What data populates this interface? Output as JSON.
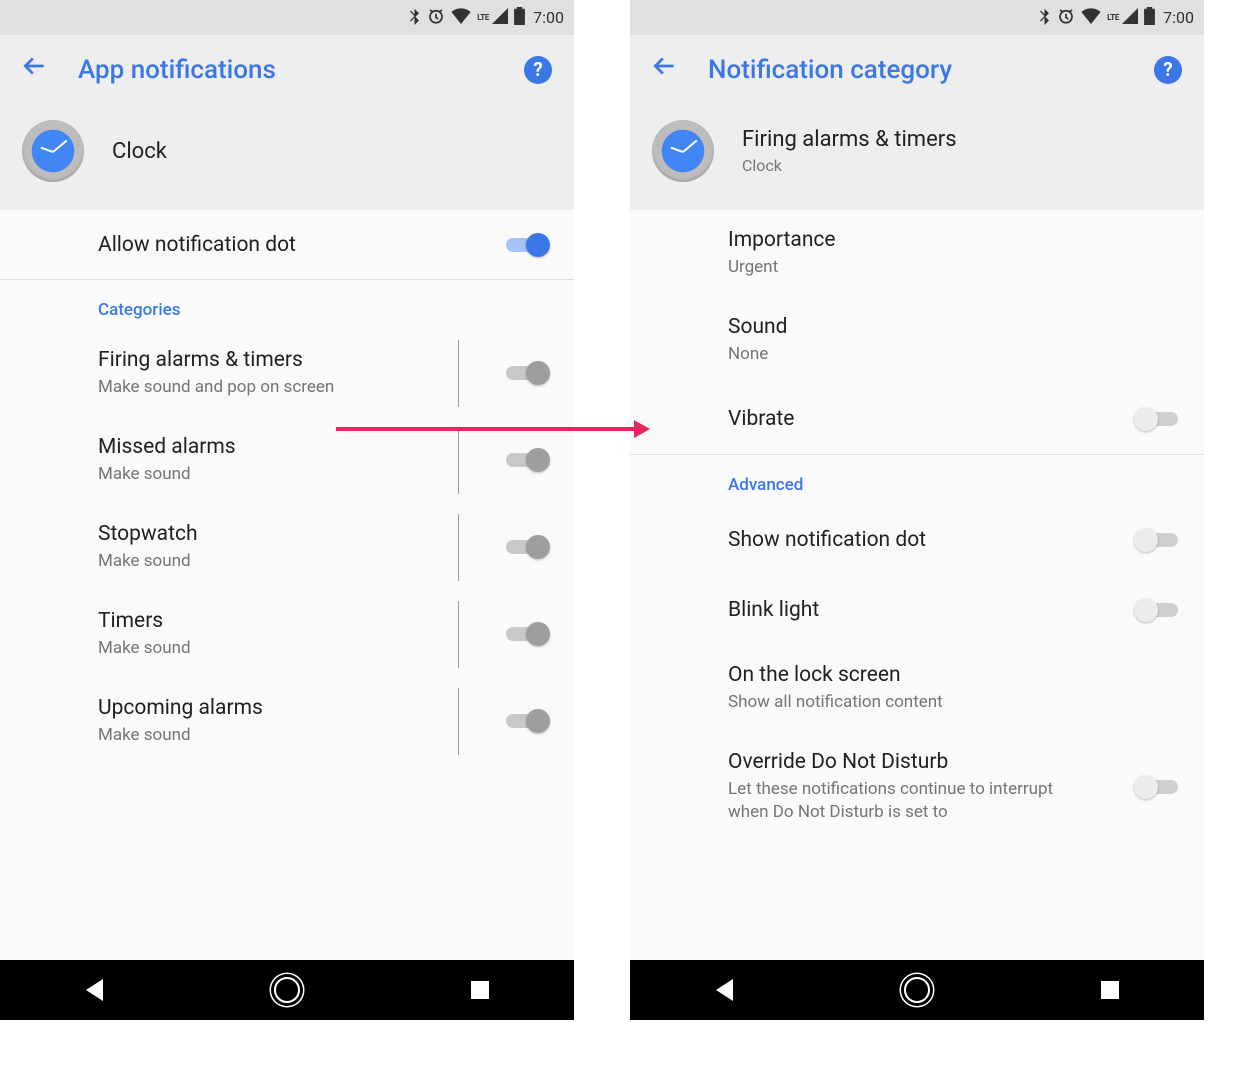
{
  "status": {
    "time": "7:00",
    "lte": "LTE"
  },
  "left": {
    "title": "App notifications",
    "app_name": "Clock",
    "allow_dot": "Allow notification dot",
    "section": "Categories",
    "categories": [
      {
        "title": "Firing alarms & timers",
        "sub": "Make sound and pop on screen"
      },
      {
        "title": "Missed alarms",
        "sub": "Make sound"
      },
      {
        "title": "Stopwatch",
        "sub": "Make sound"
      },
      {
        "title": "Timers",
        "sub": "Make sound"
      },
      {
        "title": "Upcoming alarms",
        "sub": "Make sound"
      }
    ]
  },
  "right": {
    "title": "Notification category",
    "app_title": "Firing alarms & timers",
    "app_sub": "Clock",
    "importance_label": "Importance",
    "importance_value": "Urgent",
    "sound_label": "Sound",
    "sound_value": "None",
    "vibrate": "Vibrate",
    "advanced": "Advanced",
    "show_dot": "Show notification dot",
    "blink": "Blink light",
    "lockscreen_label": "On the lock screen",
    "lockscreen_value": "Show all notification content",
    "override_label": "Override Do Not Disturb",
    "override_sub": "Let these notifications continue to interrupt when Do Not Disturb is set to"
  }
}
